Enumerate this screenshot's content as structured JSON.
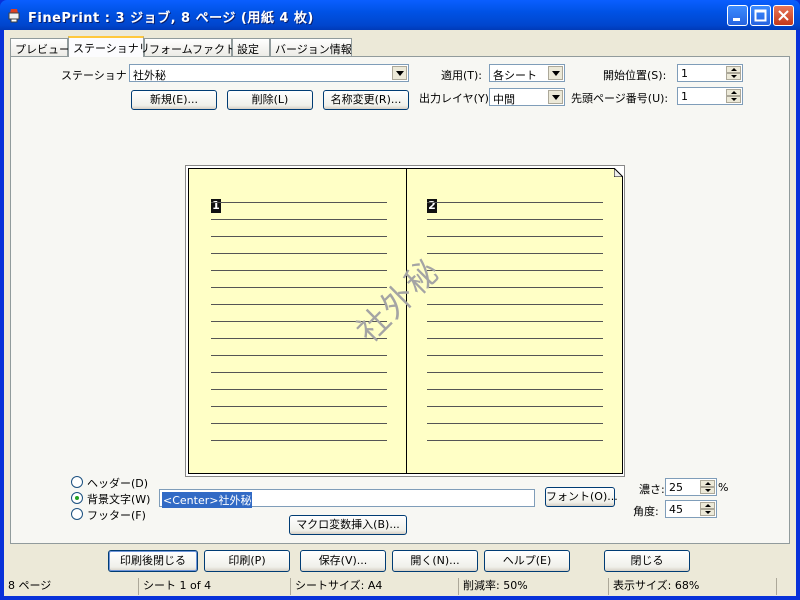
{
  "window": {
    "title": "FinePrint : 3 ジョブ, 8 ページ (用紙 4 枚)"
  },
  "tabs": [
    {
      "label": "プレビュー"
    },
    {
      "label": "ステーショナリ"
    },
    {
      "label": "フォームファクトリ"
    },
    {
      "label": "設定"
    },
    {
      "label": "バージョン情報"
    }
  ],
  "active_tab": "ステーショナリ",
  "stationery": {
    "label": "ステーショナリ(I):",
    "value": "社外秘",
    "new_button": "新規(E)...",
    "delete_button": "削除(L)",
    "rename_button": "名称変更(R)..."
  },
  "apply": {
    "label": "適用(T):",
    "value": "各シート"
  },
  "output_layer": {
    "label": "出力レイヤ(Y):",
    "value": "中間"
  },
  "start_position": {
    "label": "開始位置(S):",
    "value": "1"
  },
  "first_page_number": {
    "label": "先頭ページ番号(U):",
    "value": "1"
  },
  "preview": {
    "page_numbers": [
      "1",
      "2"
    ],
    "watermark": "社外秘"
  },
  "text_mode": {
    "header_label": "ヘッダー(D)",
    "background_label": "背景文字(W)",
    "footer_label": "フッター(F)",
    "selected": "background",
    "text_value": "<Center>社外秘",
    "font_button": "フォント(O)...",
    "macro_button": "マクロ変数挿入(B)..."
  },
  "density": {
    "label": "濃さ:",
    "value": "25",
    "unit": "%"
  },
  "angle": {
    "label": "角度:",
    "value": "45"
  },
  "bottom_buttons": {
    "close_after_print": "印刷後閉じる",
    "print": "印刷(P)",
    "save": "保存(V)...",
    "open": "開く(N)...",
    "help": "ヘルプ(E)",
    "close": "閉じる"
  },
  "status": {
    "pages": "8 ページ",
    "sheet": "シート 1 of 4",
    "sheet_size": "シートサイズ: A4",
    "reduction": "削減率: 50%",
    "display_size": "表示サイズ: 68%"
  }
}
